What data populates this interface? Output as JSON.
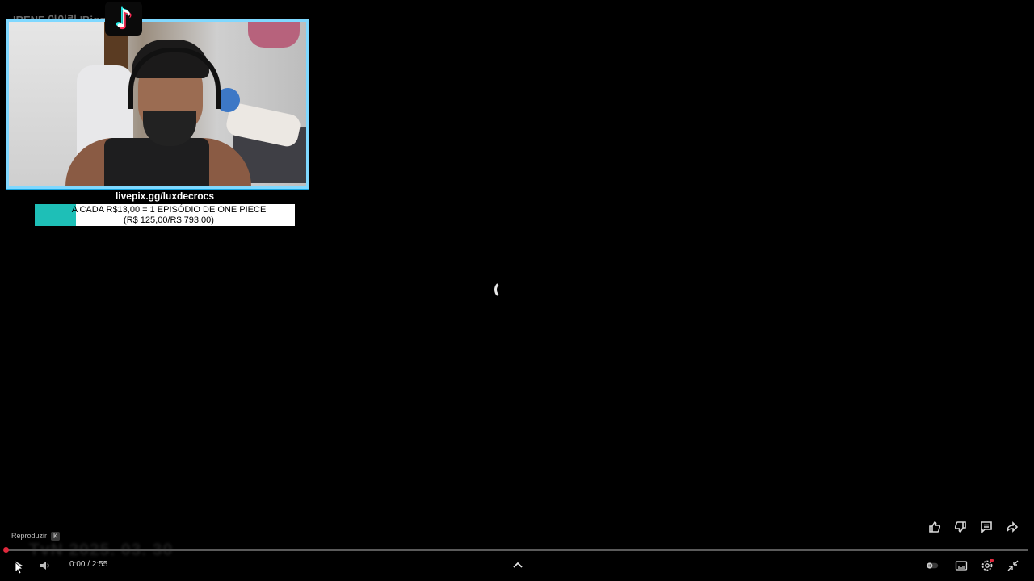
{
  "video": {
    "title": "IRENE 아이린 'Bigg... MV"
  },
  "overlay": {
    "donation_link": "livepix.gg/luxdecrocs",
    "goal_line1": "A CADA R$13,00 = 1 EPISÓDIO DE ONE PIECE",
    "goal_line2": "(R$ 125,00/R$ 793,00)",
    "goal_progress": 0.158,
    "goal_fill_color": "#1ebfb7"
  },
  "watermark": {
    "text": "TvN  2025. 03. 30"
  },
  "player": {
    "tooltip_label": "Reproduzir",
    "tooltip_key": "K",
    "time_display": "0:00 / 2:55",
    "progress": 0,
    "accent_color": "#e0283c"
  },
  "icons": {
    "play": "play-icon",
    "volume": "volume-icon",
    "expand": "chevron-up-icon",
    "autoplay": "autoplay-toggle-icon",
    "subtitles": "subtitles-icon",
    "settings": "gear-icon",
    "exit_fullscreen": "exit-fullscreen-icon",
    "like": "thumbs-up-icon",
    "dislike": "thumbs-down-icon",
    "comments": "comment-icon",
    "share": "share-icon",
    "tiktok": "tiktok-logo-icon"
  }
}
